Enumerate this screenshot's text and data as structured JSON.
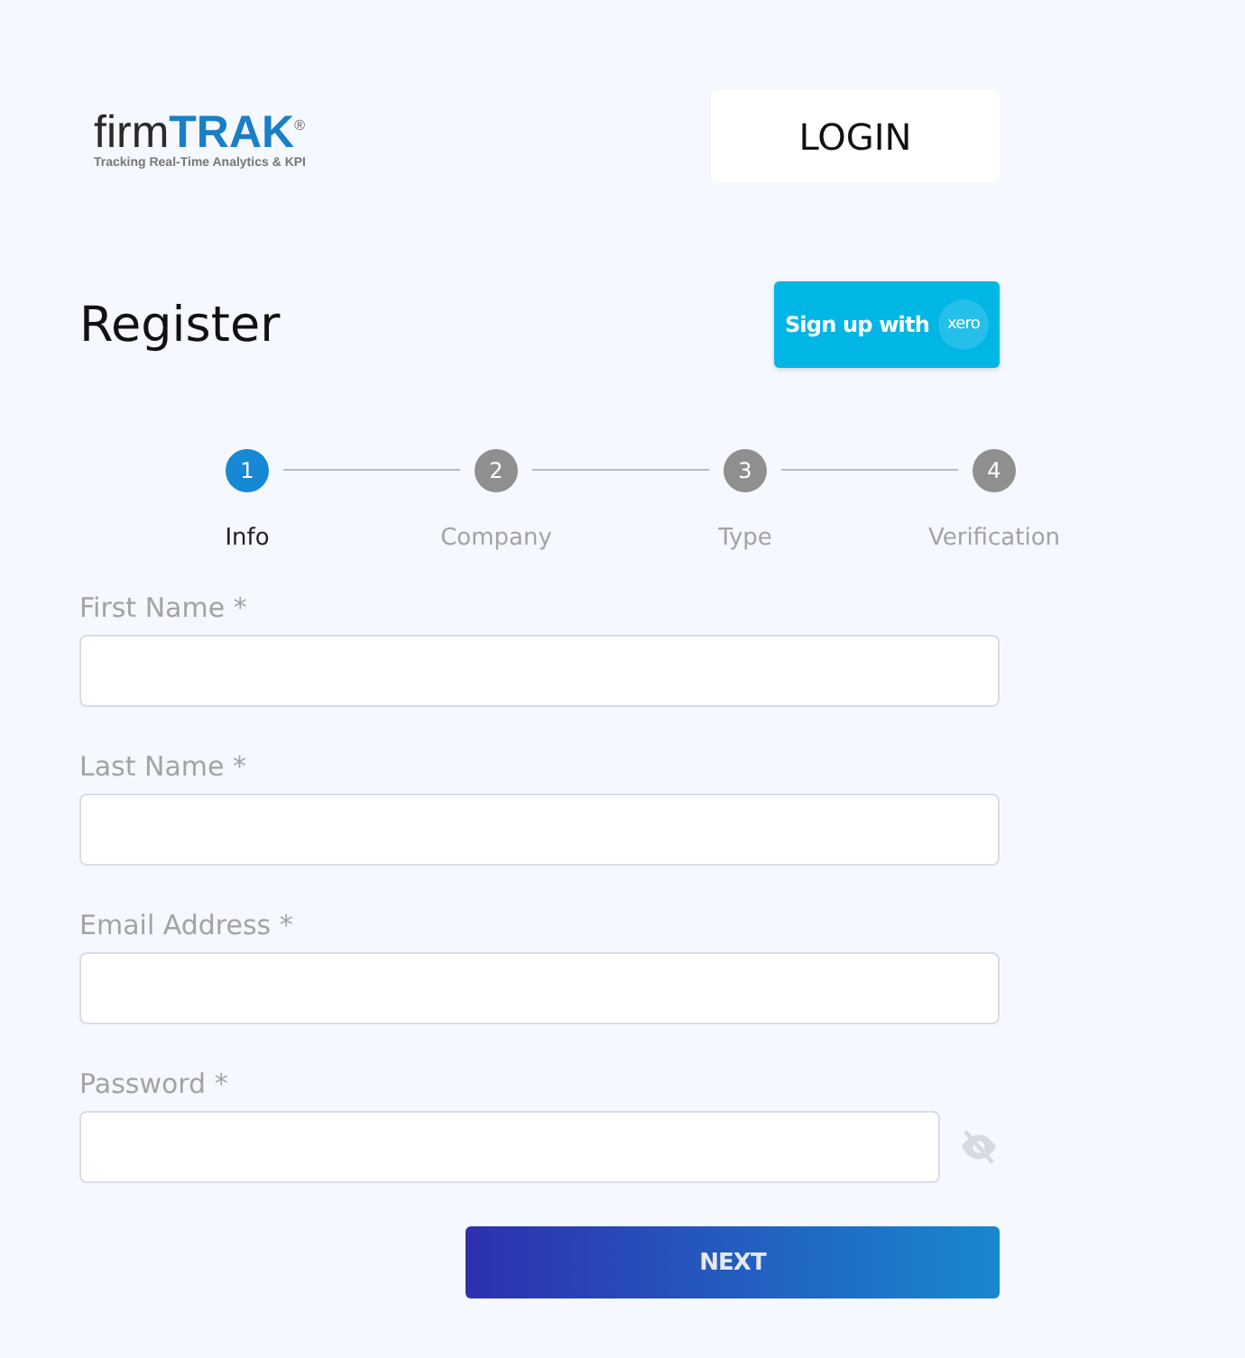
{
  "logo": {
    "prefix": "firm",
    "brand": "TRAK",
    "mark": "®",
    "tagline": "Tracking Real-Time Analytics & KPI"
  },
  "login_button": "LOGIN",
  "title": "Register",
  "signup_button": {
    "label": "Sign up with",
    "partner": "xero"
  },
  "steps": [
    {
      "number": "1",
      "label": "Info",
      "selected": true
    },
    {
      "number": "2",
      "label": "Company",
      "selected": false
    },
    {
      "number": "3",
      "label": "Type",
      "selected": false
    },
    {
      "number": "4",
      "label": "Verification",
      "selected": false
    }
  ],
  "fields": [
    {
      "label": "First Name *",
      "kind": "text"
    },
    {
      "label": "Last Name *",
      "kind": "text"
    },
    {
      "label": "Email Address *",
      "kind": "text"
    },
    {
      "label": "Password *",
      "kind": "password"
    }
  ],
  "next_button": "NEXT"
}
